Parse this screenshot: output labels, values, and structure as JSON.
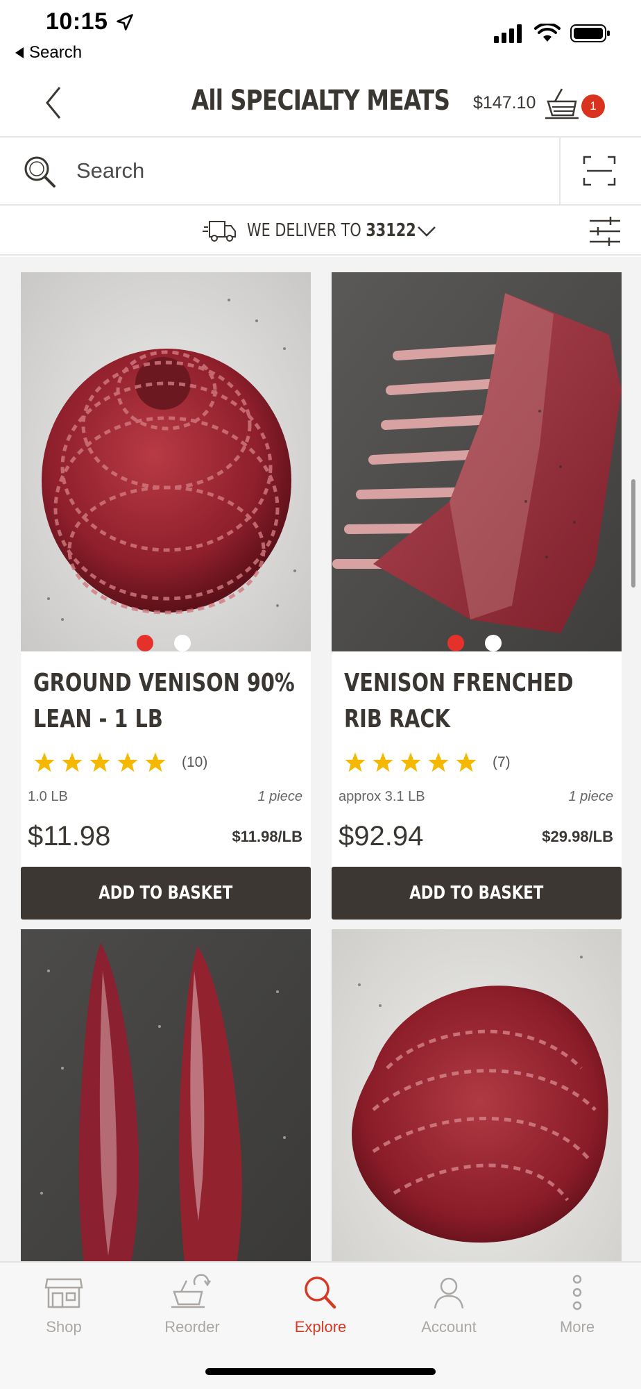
{
  "status_bar": {
    "time": "10:15",
    "back_app": "Search"
  },
  "header": {
    "title": "All SPECIALTY MEATS",
    "cart_total": "$147.10",
    "cart_count": "1"
  },
  "search": {
    "placeholder": "Search"
  },
  "delivery": {
    "prefix": "WE DELIVER TO",
    "zip": "33122"
  },
  "colors": {
    "accent": "#d53a26",
    "button": "#3c3733",
    "star": "#f5b700",
    "badge": "#d9331f"
  },
  "products": [
    {
      "name": "GROUND VENISON 90% LEAN  - 1 LB",
      "rating": 5,
      "review_count": "(10)",
      "weight": "1.0 LB",
      "pieces": "1 piece",
      "price": "$11.98",
      "unit_price": "$11.98/LB",
      "button": "ADD TO BASKET"
    },
    {
      "name": "VENISON FRENCHED RIB RACK",
      "rating": 5,
      "review_count": "(7)",
      "weight": "approx 3.1 LB",
      "pieces": "1 piece",
      "price": "$92.94",
      "unit_price": "$29.98/LB",
      "button": "ADD TO BASKET"
    }
  ],
  "tabs": [
    {
      "label": "Shop",
      "icon": "store-icon"
    },
    {
      "label": "Reorder",
      "icon": "reorder-basket-icon"
    },
    {
      "label": "Explore",
      "icon": "search-icon",
      "active": true
    },
    {
      "label": "Account",
      "icon": "person-icon"
    },
    {
      "label": "More",
      "icon": "more-vertical-icon"
    }
  ]
}
